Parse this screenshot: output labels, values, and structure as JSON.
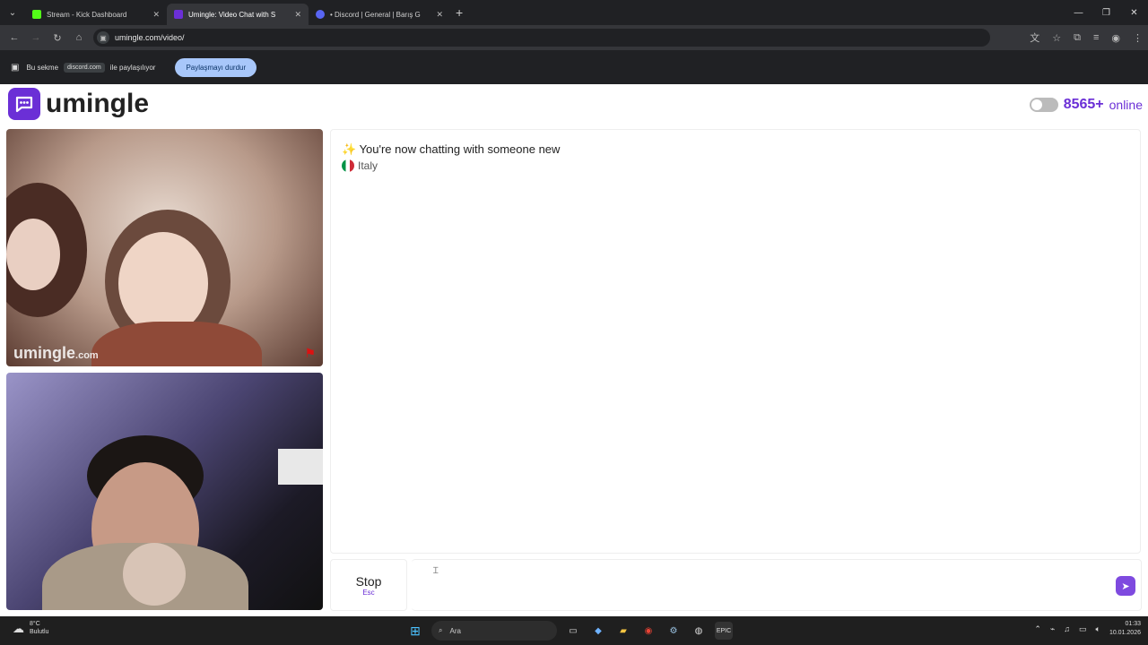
{
  "browser": {
    "tabs": [
      {
        "title": "Stream - Kick Dashboard",
        "color": "#53fc18",
        "active": false
      },
      {
        "title": "Umingle: Video Chat with S",
        "color": "#6b2fd6",
        "active": true
      },
      {
        "title": "• Discord | General | Barış G",
        "color": "#5865f2",
        "active": false
      }
    ],
    "url": "umingle.com/video/"
  },
  "share_bar": {
    "prefix": "Bu sekme",
    "site": "discord.com",
    "suffix": "ile paylaşılıyor",
    "stop_label": "Paylaşmayı durdur"
  },
  "site": {
    "logo_text": "umingle",
    "online_count": "8565+",
    "online_label": "online",
    "watermark": "umingle",
    "watermark_tld": ".com"
  },
  "chat": {
    "system_message": "✨  You're now chatting with someone new",
    "country": "Italy"
  },
  "controls": {
    "stop_label": "Stop",
    "stop_key": "Esc"
  },
  "taskbar": {
    "temperature": "8°C",
    "weather": "Bulutlu",
    "search_label": "Ara",
    "time": "01:33",
    "date": "10.01.2026"
  }
}
